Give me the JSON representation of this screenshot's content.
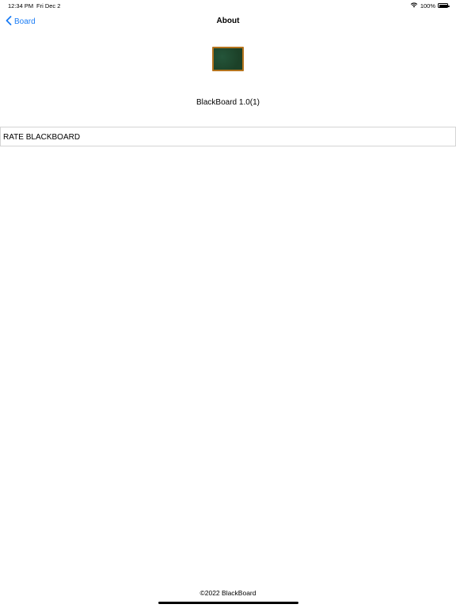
{
  "status_bar": {
    "time": "12:34 PM",
    "date": "Fri Dec 2",
    "battery": "100%",
    "icons": [
      "wifi-icon",
      "battery-icon"
    ]
  },
  "nav": {
    "back_label": "Board",
    "back_icon": "chevron-left-icon",
    "title": "About"
  },
  "app": {
    "icon": "blackboard-app-icon",
    "version": "BlackBoard 1.0(1)"
  },
  "actions": {
    "rate_label": "RATE BLACKBOARD"
  },
  "footer": {
    "copyright": "©2022 BlackBoard"
  },
  "colors": {
    "accent": "#1a7cf5",
    "board_green": "#1f4a2c",
    "board_frame": "#b5741e"
  }
}
